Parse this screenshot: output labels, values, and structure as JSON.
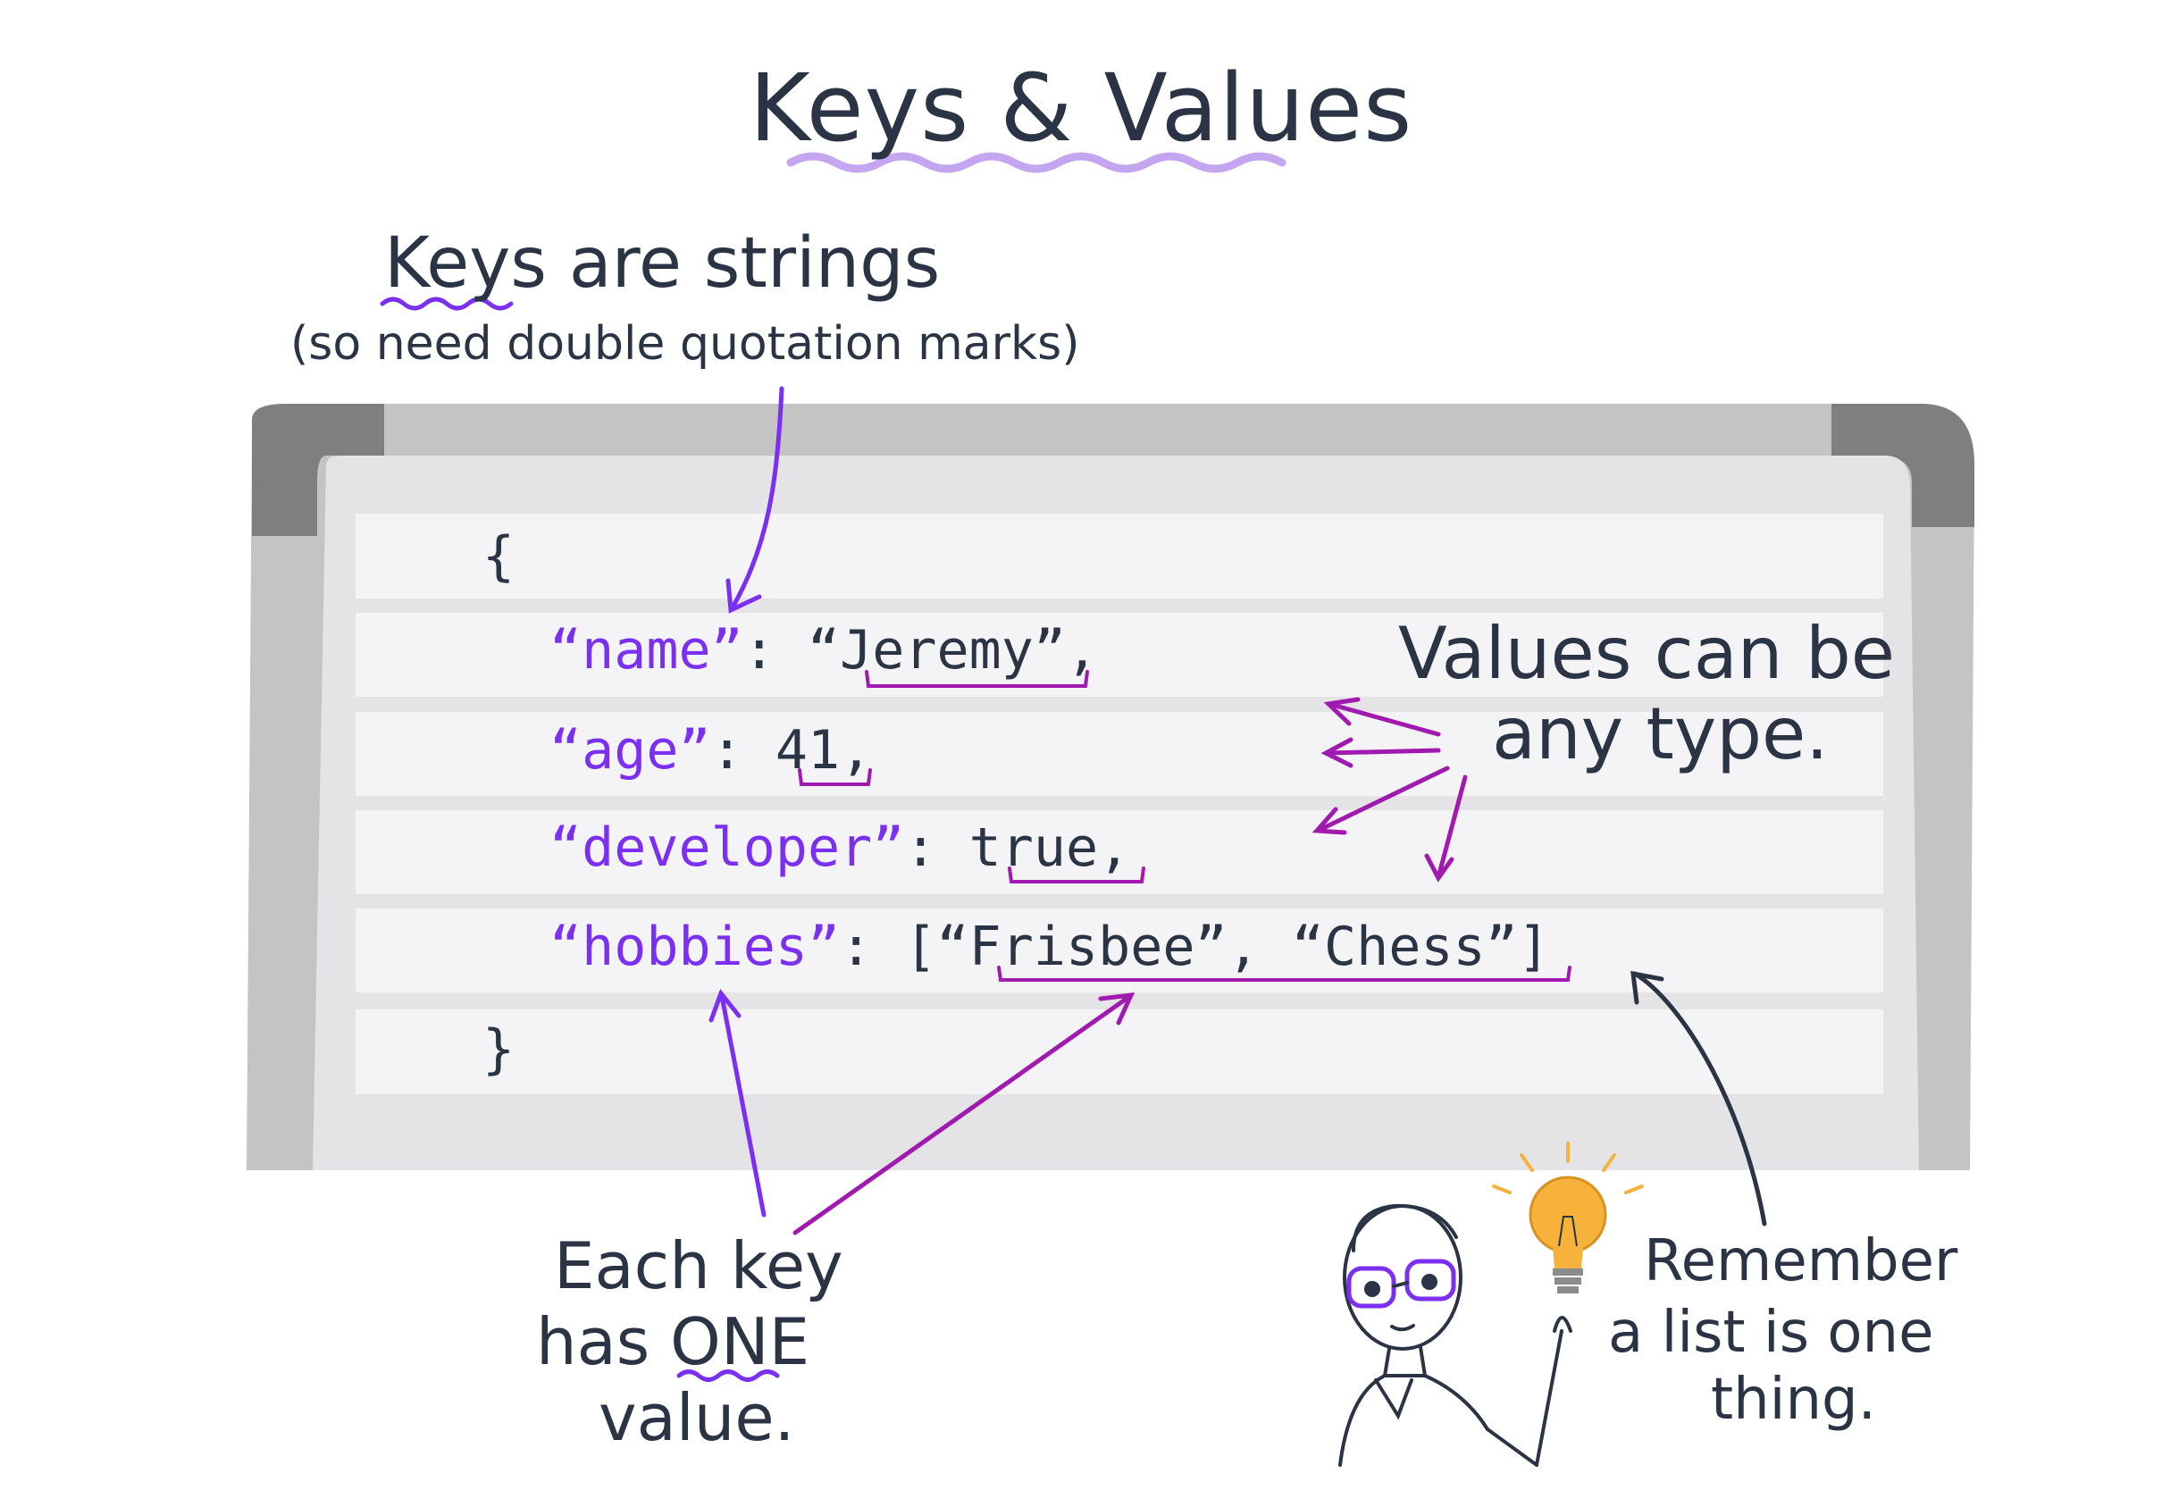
{
  "title": "Keys & Values",
  "annotations": {
    "keys_heading": "Keys are strings",
    "keys_sub": "(so need double quotation marks)",
    "values_line1": "Values can be",
    "values_line2": "any type.",
    "each_key_line1": "Each key",
    "each_key_line2": "has ONE",
    "each_key_line3": "value.",
    "remember_line1": "Remember",
    "remember_line2": "a list is one",
    "remember_line3": "thing."
  },
  "code": {
    "open_brace": "{",
    "close_brace": "}",
    "lines": [
      {
        "key": "“name”",
        "sep": ": ",
        "value": "“Jeremy”",
        "end": ","
      },
      {
        "key": "“age”",
        "sep": ": ",
        "value": "41",
        "end": ","
      },
      {
        "key": "“developer”",
        "sep": ": ",
        "value": "true",
        "end": ","
      },
      {
        "key": "“hobbies”",
        "sep": ": ",
        "value": "[“Frisbee”, “Chess”]",
        "end": ""
      }
    ]
  },
  "colors": {
    "ink": "#2b3444",
    "key_purple": "#7b2ff0",
    "arrow_magenta": "#a01ab0",
    "wavy_lavender": "#c4a6f0",
    "board_frame": "#bdbdbd",
    "board_corner": "#7f7f7f",
    "board_surface": "#e6e6e6",
    "code_row": "#f4f4f6",
    "bulb": "#f6b23a"
  },
  "icons": [
    "lightbulb-icon",
    "scientist-character"
  ]
}
